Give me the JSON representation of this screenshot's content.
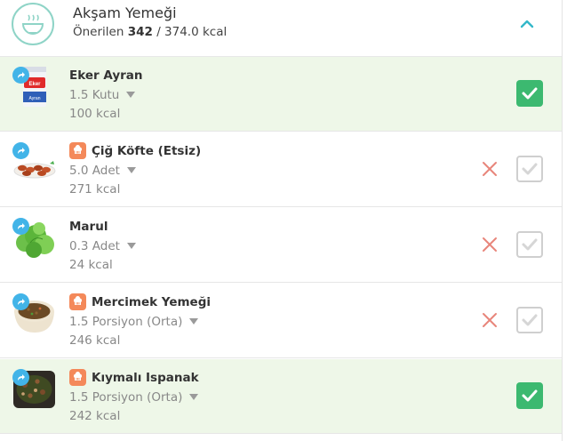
{
  "meal": {
    "title": "Akşam Yemeği",
    "recommended_label": "Önerilen",
    "recommended_value": "342",
    "total": "/ 374.0 kcal"
  },
  "items": [
    {
      "name": "Eker Ayran",
      "quantity": "1.5 Kutu",
      "kcal": "100 kcal",
      "is_recipe": false,
      "checked": true,
      "thumb_label": "Eker",
      "thumb_sub": "Ayran"
    },
    {
      "name": "Çiğ Köfte (Etsiz)",
      "quantity": "5.0 Adet",
      "kcal": "271 kcal",
      "is_recipe": true,
      "checked": false
    },
    {
      "name": "Marul",
      "quantity": "0.3 Adet",
      "kcal": "24 kcal",
      "is_recipe": false,
      "checked": false
    },
    {
      "name": "Mercimek Yemeği",
      "quantity": "1.5 Porsiyon (Orta)",
      "kcal": "246 kcal",
      "is_recipe": true,
      "checked": false
    },
    {
      "name": "Kıymalı Ispanak",
      "quantity": "1.5 Porsiyon (Orta)",
      "kcal": "242 kcal",
      "is_recipe": true,
      "checked": true
    }
  ],
  "colors": {
    "accent": "#3cb970",
    "selected_row": "#eef7e8",
    "share": "#42b4e8",
    "recipe": "#f4895a",
    "remove": "#e8857a",
    "chevron": "#34b8c9"
  },
  "icons": {
    "meal": "bowl-icon",
    "collapse": "chevron-up-icon",
    "share": "share-arrow-icon",
    "recipe": "chef-hat-icon",
    "remove": "close-icon",
    "check": "checkmark-icon"
  }
}
